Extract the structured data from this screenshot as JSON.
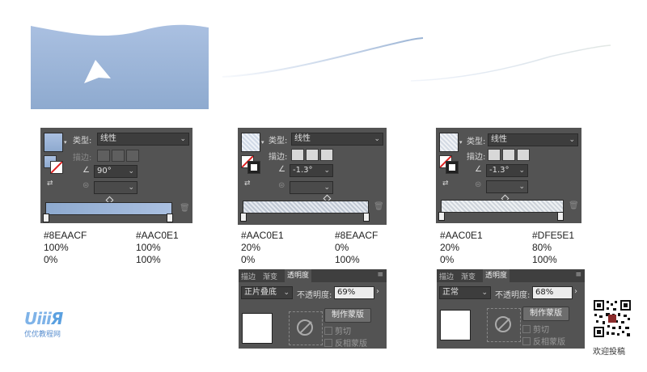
{
  "palette": {
    "panel_bg": "#535353",
    "grad_start": "#8EAACF",
    "grad_end": "#AAC0E1",
    "grad_end_light": "#DFE5E1"
  },
  "gradient_panels": [
    {
      "type_label": "类型:",
      "type_value": "线性",
      "stroke_label": "描边:",
      "angle_value": "90°",
      "stops": [
        {
          "color": "#8EAACF",
          "opacity": "100%",
          "position": "0%"
        },
        {
          "color": "#AAC0E1",
          "opacity": "100%",
          "position": "100%"
        }
      ]
    },
    {
      "type_label": "类型:",
      "type_value": "线性",
      "stroke_label": "描边:",
      "angle_value": "-1.3°",
      "stops": [
        {
          "color": "#AAC0E1",
          "opacity": "20%",
          "position": "0%"
        },
        {
          "color": "#8EAACF",
          "opacity": "0%",
          "position": "100%"
        }
      ]
    },
    {
      "type_label": "类型:",
      "type_value": "线性",
      "stroke_label": "描边:",
      "angle_value": "-1.3°",
      "stops": [
        {
          "color": "#AAC0E1",
          "opacity": "20%",
          "position": "0%"
        },
        {
          "color": "#DFE5E1",
          "opacity": "80%",
          "position": "100%"
        }
      ]
    }
  ],
  "transparency_panels": [
    {
      "tabs": [
        "描边",
        "渐变",
        "透明度"
      ],
      "blend_mode": "正片叠底",
      "opacity_label": "不透明度:",
      "opacity_value": "69%",
      "make_mask": "制作蒙版",
      "clip": "剪切",
      "invert": "反相蒙版"
    },
    {
      "tabs": [
        "描边",
        "渐变",
        "透明度"
      ],
      "blend_mode": "正常",
      "opacity_label": "不透明度:",
      "opacity_value": "68%",
      "make_mask": "制作蒙版",
      "clip": "剪切",
      "invert": "反相蒙版"
    }
  ],
  "logo": {
    "brand": "uiiiuiii",
    "subtitle": "优优教程网"
  },
  "qr_caption": "欢迎投稿"
}
